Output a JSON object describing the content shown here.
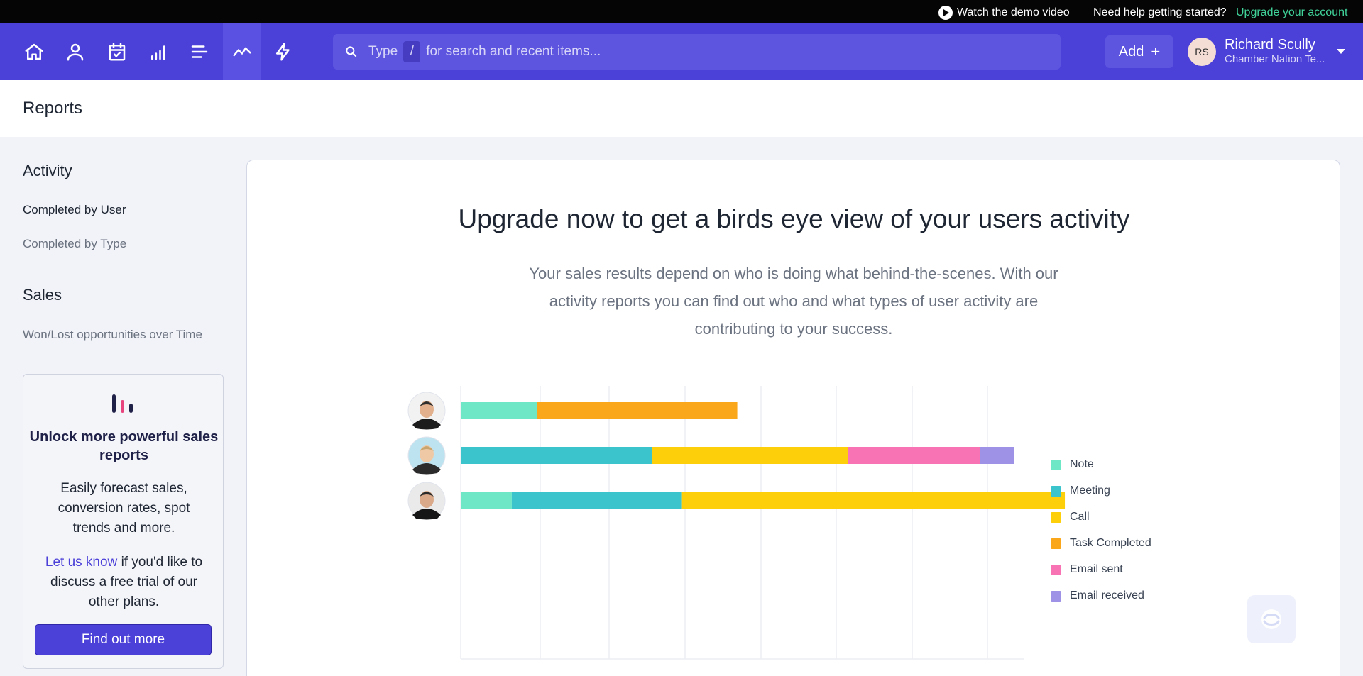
{
  "topbar": {
    "demo_label": "Watch the demo video",
    "help_label": "Need help getting started?",
    "upgrade_label": "Upgrade your account",
    "upgrade_color": "#40d39a"
  },
  "nav": {
    "icons": [
      "home-icon",
      "contacts-icon",
      "calendar-icon",
      "pipeline-icon",
      "list-icon",
      "reports-icon",
      "automation-icon"
    ],
    "active": "reports-icon",
    "search": {
      "type_label": "Type",
      "key": "/",
      "placeholder": "for search and recent items..."
    },
    "add_label": "Add",
    "user": {
      "initials": "RS",
      "name": "Richard Scully",
      "org": "Chamber Nation Te..."
    },
    "bg_color": "#4b40d8"
  },
  "page": {
    "title": "Reports"
  },
  "sidebar": {
    "sections": [
      {
        "title": "Activity",
        "items": [
          "Completed by User",
          "Completed by Type"
        ]
      },
      {
        "title": "Sales",
        "items": [
          "Won/Lost opportunities over Time"
        ]
      }
    ],
    "active_item": "Completed by User",
    "promo": {
      "title": "Unlock more powerful sales reports",
      "desc": "Easily forecast sales, conversion rates, spot trends and more.",
      "link": "Let us know",
      "link_rest": " if you'd like to discuss a free trial of our other plans.",
      "button": "Find out more"
    }
  },
  "main": {
    "title": "Upgrade now to get a birds eye view of your users activity",
    "subtitle": "Your sales results depend on who is doing what behind-the-scenes. With our activity reports you can find out who and what types of user activity are contributing to your success."
  },
  "chart_data": {
    "type": "bar",
    "orientation": "horizontal",
    "stacked": true,
    "categories": [
      "User 1",
      "User 2",
      "User 3"
    ],
    "category_labels_shown": false,
    "series": [
      {
        "name": "Note",
        "color": "#6ee7c6",
        "values": [
          9,
          0,
          6
        ]
      },
      {
        "name": "Meeting",
        "color": "#3bc4cc",
        "values": [
          0,
          22.5,
          20
        ]
      },
      {
        "name": "Call",
        "color": "#fdce0a",
        "values": [
          0,
          23,
          45
        ]
      },
      {
        "name": "Task Completed",
        "color": "#fba71c",
        "values": [
          23.5,
          0,
          0
        ]
      },
      {
        "name": "Email sent",
        "color": "#f773b4",
        "values": [
          0,
          15.5,
          0
        ]
      },
      {
        "name": "Email received",
        "color": "#9e92e6",
        "values": [
          0,
          4,
          0
        ]
      }
    ],
    "xlim": [
      0,
      75
    ],
    "grid": true,
    "axis_labels_shown": false,
    "legend_position": "right"
  }
}
